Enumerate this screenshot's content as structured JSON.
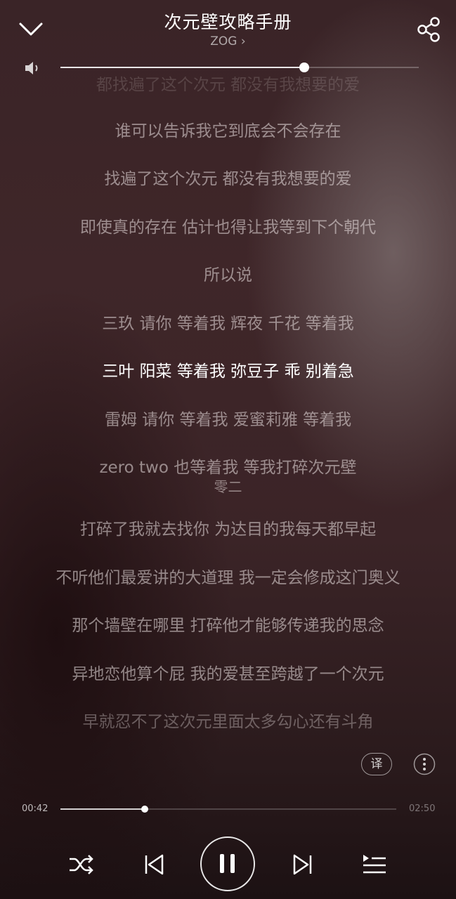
{
  "header": {
    "title": "次元壁攻略手册",
    "artist": "ZOG",
    "artist_chevron": "›"
  },
  "volume": {
    "level": 0.68
  },
  "lyrics": {
    "lines": [
      "都找遍了这个次元 都没有我想要的爱",
      "谁可以告诉我它到底会不会存在",
      "找遍了这个次元 都没有我想要的爱",
      "即使真的存在 估计也得让我等到下个朝代",
      "所以说",
      "三玖 请你 等着我 辉夜 千花 等着我",
      "三叶 阳菜 等着我 弥豆子 乖 别着急",
      "雷姆 请你 等着我 爱蜜莉雅 等着我",
      "zero two 也等着我 等我打碎次元壁",
      "打碎了我就去找你 为达目的我每天都早起",
      "不听他们最爱讲的大道理 我一定会修成这门奥义",
      "那个墙壁在哪里 打碎他才能够传递我的思念",
      "异地恋他算个屁 我的爱甚至跨越了一个次元",
      "早就忍不了这次元里面太多勾心还有斗角"
    ],
    "sub_line": "零二",
    "current_index": 6
  },
  "actions": {
    "translate_label": "译"
  },
  "progress": {
    "current_time": "00:42",
    "total_time": "02:50",
    "fraction": 0.25
  },
  "colors": {
    "background": "#3a2427",
    "accent": "#ffffff"
  },
  "icons": {
    "back": "chevron-down-icon",
    "share": "share-icon",
    "volume": "speaker-icon",
    "more": "more-vertical-icon",
    "shuffle": "shuffle-icon",
    "prev": "skip-previous-icon",
    "play": "pause-icon",
    "next": "skip-next-icon",
    "playlist": "playlist-icon"
  }
}
